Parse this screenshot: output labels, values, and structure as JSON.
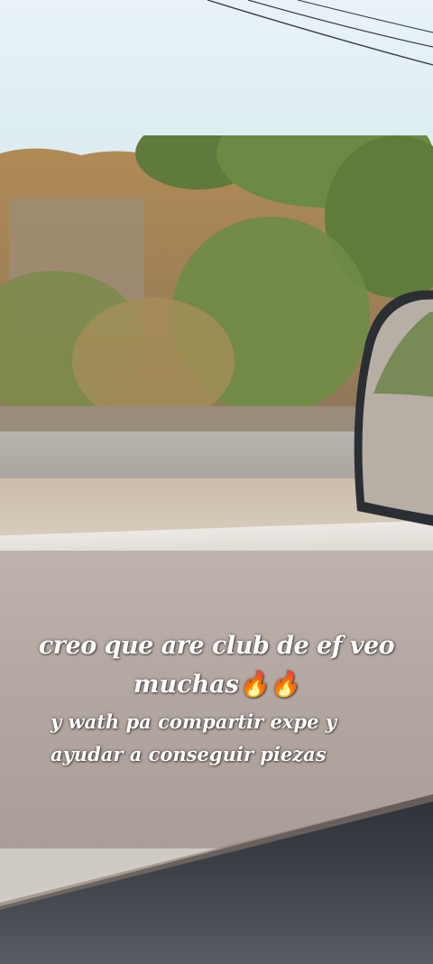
{
  "caption": {
    "line1": "creo que are club de ef veo",
    "line2_text": "muchas",
    "line2_emoji": "🔥🔥",
    "line3": "y wath pa compartir expe y",
    "line4": "ayudar a conseguir piezas"
  },
  "colors": {
    "sky": "#e4f0f4",
    "road": "#b5a8a2",
    "caption_text": "#ffffff",
    "dashboard": "#2d3238"
  }
}
